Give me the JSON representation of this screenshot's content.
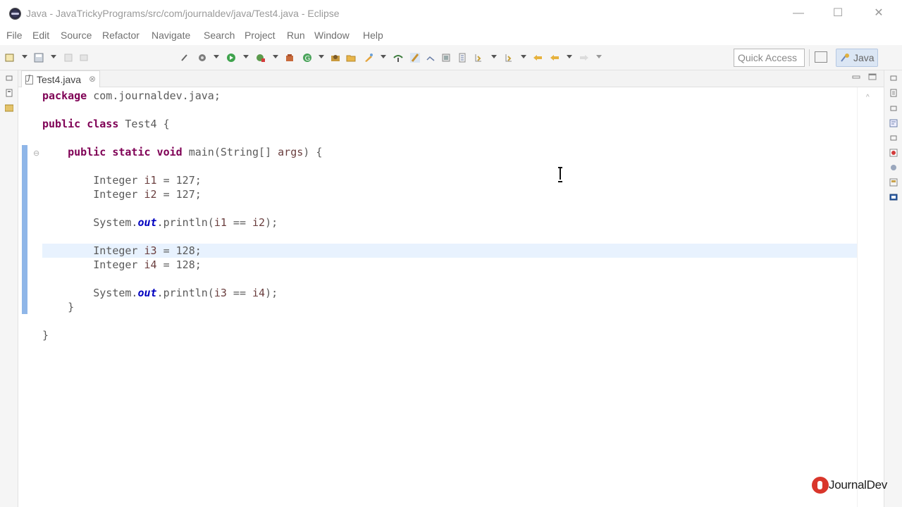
{
  "window": {
    "title": "Java - JavaTrickyPrograms/src/com/journaldev/java/Test4.java - Eclipse",
    "controls": {
      "minimize": "—",
      "maximize": "☐",
      "close": "✕"
    }
  },
  "menu": [
    {
      "label": "File"
    },
    {
      "label": "Edit"
    },
    {
      "label": "Source"
    },
    {
      "label": "Refactor"
    },
    {
      "label": "Navigate"
    },
    {
      "label": "Search"
    },
    {
      "label": "Project"
    },
    {
      "label": "Run"
    },
    {
      "label": "Window"
    },
    {
      "label": "Help"
    }
  ],
  "toolbar": {
    "quick_access_placeholder": "Quick Access",
    "perspective": "Java"
  },
  "editor": {
    "tab_label": "Test4.java",
    "tab_close": "⊗",
    "fold_marker": "⊖",
    "overview_up": "^",
    "code_lines": [
      "package com.journaldev.java;",
      "",
      "public class Test4 {",
      "",
      "    public static void main(String[] args) {",
      "",
      "        Integer i1 = 127;",
      "        Integer i2 = 127;",
      "",
      "        System.out.println(i1 == i2);",
      "",
      "        Integer i3 = 128;",
      "        Integer i4 = 128;",
      "",
      "        System.out.println(i3 == i4);",
      "    }",
      "",
      "}"
    ]
  },
  "watermark": {
    "text": "JournalDev"
  },
  "colors": {
    "keyword": "#7f0055",
    "field": "#0000c0",
    "current_line": "#e8f2fe",
    "change_bar": "#8fb6e8"
  }
}
